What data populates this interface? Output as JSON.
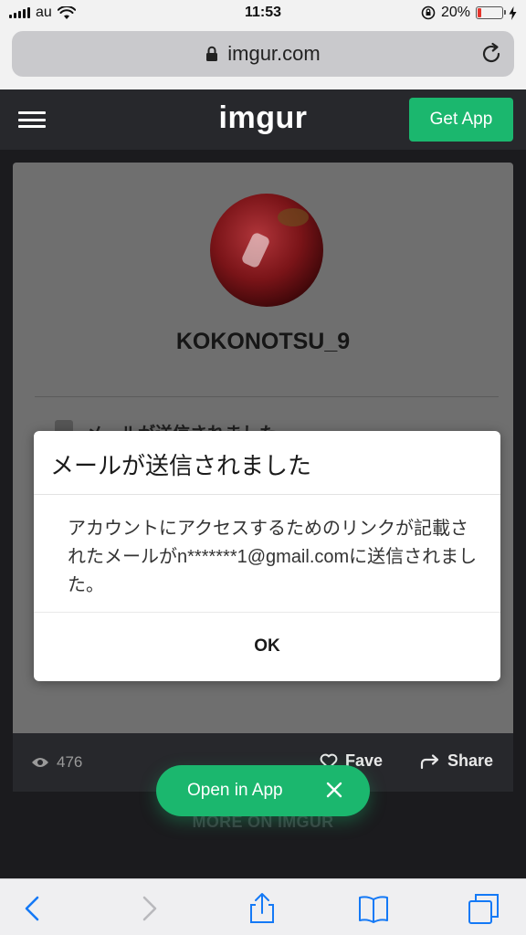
{
  "status_bar": {
    "carrier": "au",
    "time": "11:53",
    "battery_percent": "20%",
    "battery_level": 0.2,
    "battery_color": "#e5352c"
  },
  "browser": {
    "url": "imgur.com"
  },
  "header": {
    "logo": "imgur",
    "get_app_label": "Get App",
    "accent_color": "#1bb76e"
  },
  "profile": {
    "username": "KOKONOTSU_9",
    "peek_text": "メールが送信されました",
    "views_count": "476",
    "fave_label": "Fave",
    "share_label": "Share"
  },
  "more_on_label": "MORE ON IMGUR",
  "open_in_app": {
    "label": "Open in App"
  },
  "modal": {
    "title": "メールが送信されました",
    "body": "アカウントにアクセスするためのリンクが記載されたメールがn*******1@gmail.comに送信されました。",
    "ok_label": "OK"
  },
  "icons": {
    "status": [
      "signal-icon",
      "wifi-icon",
      "orientation-lock-icon",
      "battery-icon",
      "charging-icon"
    ],
    "browser": [
      "lock-icon",
      "reload-icon"
    ],
    "header": [
      "hamburger-menu-icon"
    ],
    "footer": [
      "eye-icon",
      "heart-icon",
      "share-arrow-icon",
      "close-icon"
    ],
    "toolbar": [
      "back-arrow-icon",
      "forward-arrow-icon",
      "share-sheet-icon",
      "bookmarks-icon",
      "tabs-icon"
    ]
  }
}
